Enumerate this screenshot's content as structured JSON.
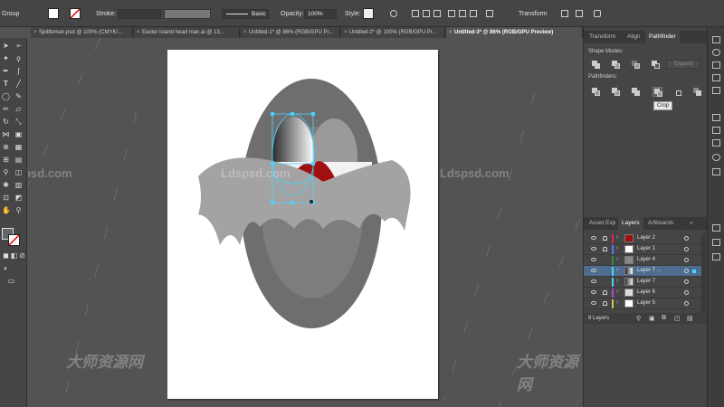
{
  "control_bar": {
    "selection_type": "Group",
    "stroke_label": "Stroke:",
    "brush_label": "Basic",
    "opacity_label": "Opacity:",
    "opacity_value": "100%",
    "style_label": "Style:",
    "transform_label": "Transform"
  },
  "doc_tabs": [
    {
      "label": "Spittleman.psd @ 100% (CMYK/..."
    },
    {
      "label": "Easter Island head man.ai @ 13..."
    },
    {
      "label": "Untitled-1* @ 86% (RGB/GPU Pr..."
    },
    {
      "label": "Untitled-2* @ 100% (RGB/GPU Pr..."
    },
    {
      "label": "Untitled-3* @ 86% (RGB/GPU Preview)"
    }
  ],
  "pathfinder_panel": {
    "tabs": [
      "Transform",
      "Align",
      "Pathfinder"
    ],
    "shape_modes_label": "Shape Modes:",
    "pathfinders_label": "Pathfinders:",
    "expand_label": "Expand",
    "tooltip": "Crop"
  },
  "layers_panel": {
    "tabs": [
      "Asset Exp",
      "Layers",
      "Artboards"
    ],
    "rows": [
      {
        "name": "Layer 2"
      },
      {
        "name": "Layer 1"
      },
      {
        "name": "Layer 4"
      },
      {
        "name": "Layer 7 ..."
      },
      {
        "name": "Layer 7"
      },
      {
        "name": "Layer 6"
      },
      {
        "name": "Layer 5"
      }
    ],
    "count": "8 Layers"
  },
  "watermarks": {
    "site": "Ldspsd.com",
    "brand": "大师资源网"
  },
  "colors": {
    "ui_dark": "#454545",
    "canvas_bg": "#535353",
    "selection_blue": "#4ad3ff",
    "tongue_red": "#a01010",
    "face_gray": "#6e6e6e",
    "whisker_gray": "#a3a3a3"
  }
}
